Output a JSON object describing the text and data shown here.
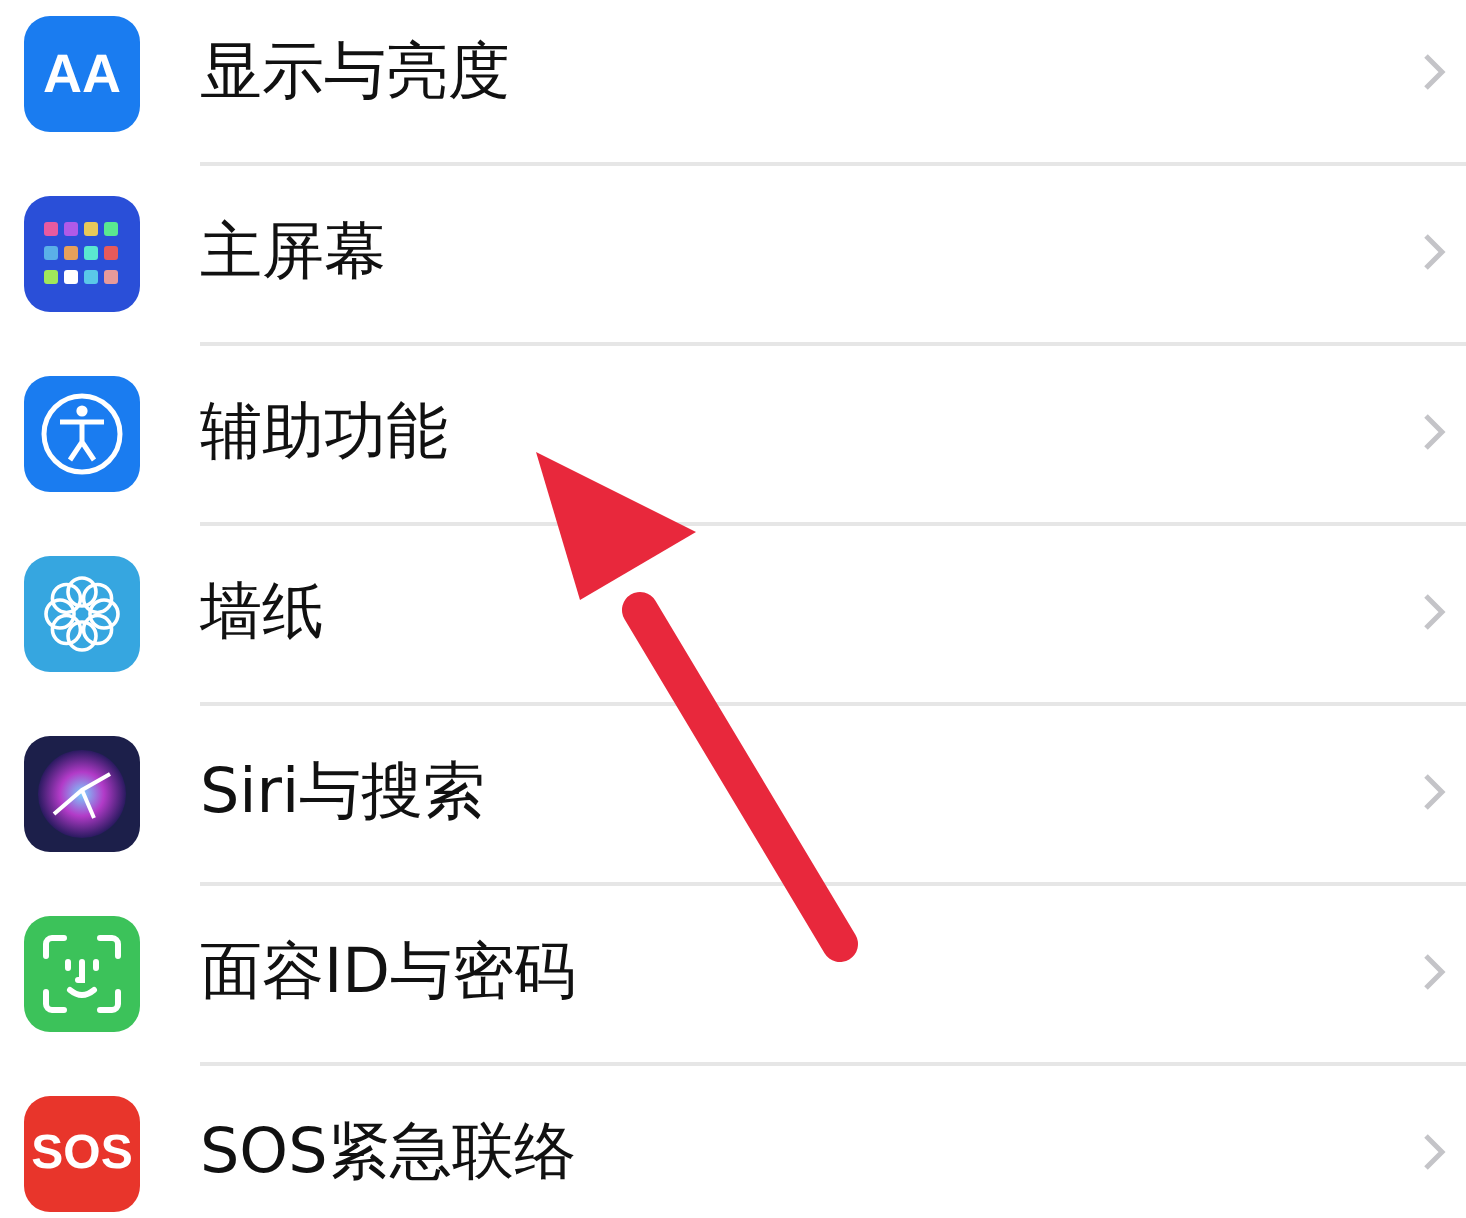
{
  "rows": [
    {
      "label": "显示与亮度",
      "kind": "text",
      "icon_text": "AA",
      "color": "#1a7cf0"
    },
    {
      "label": "主屏幕",
      "kind": "grid",
      "color": "#2a4fd8"
    },
    {
      "label": "辅助功能",
      "kind": "accessibility",
      "color": "#1a7cf0"
    },
    {
      "label": "墙纸",
      "kind": "flower",
      "color": "#36a6e0"
    },
    {
      "label": "Siri与搜索",
      "kind": "siri",
      "color": "#1c1f4a"
    },
    {
      "label": "面容ID与密码",
      "kind": "faceid",
      "color": "#3cc25a"
    },
    {
      "label": "SOS紧急联络",
      "kind": "text",
      "icon_text": "SOS",
      "color": "#e8352b"
    }
  ],
  "annotation": {
    "kind": "arrow",
    "color": "#e8283c"
  }
}
